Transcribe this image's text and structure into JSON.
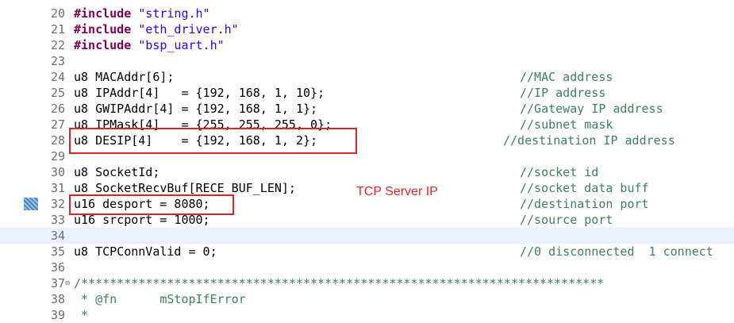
{
  "lines": [
    {
      "num": "20",
      "parts": [
        {
          "t": "#include ",
          "c": "kw"
        },
        {
          "t": "\"string.h\"",
          "c": "str"
        }
      ],
      "comment": ""
    },
    {
      "num": "21",
      "parts": [
        {
          "t": "#include ",
          "c": "kw"
        },
        {
          "t": "\"eth_driver.h\"",
          "c": "str"
        }
      ],
      "comment": ""
    },
    {
      "num": "22",
      "parts": [
        {
          "t": "#include ",
          "c": "kw"
        },
        {
          "t": "\"bsp_uart.h\"",
          "c": "str"
        }
      ],
      "comment": ""
    },
    {
      "num": "23",
      "parts": [],
      "comment": ""
    },
    {
      "num": "24",
      "parts": [
        {
          "t": "u8 MACAddr[6];",
          "c": ""
        }
      ],
      "comment": "//MAC address"
    },
    {
      "num": "25",
      "parts": [
        {
          "t": "u8 IPAddr[4]   = {192, 168, 1, 10};",
          "c": ""
        }
      ],
      "comment": "//IP address"
    },
    {
      "num": "26",
      "parts": [
        {
          "t": "u8 GWIPAddr[4] = {192, 168, 1, 1};",
          "c": ""
        }
      ],
      "comment": "//Gateway IP address"
    },
    {
      "num": "27",
      "parts": [
        {
          "t": "u8 IPMask[4]   = {255, 255, 255, 0};",
          "c": ""
        }
      ],
      "comment": "//subnet mask"
    },
    {
      "num": "28",
      "parts": [
        {
          "t": "u8 DESIP[4]    = {192, 168, 1, 2};",
          "c": ""
        }
      ],
      "comment": "//destination IP address"
    },
    {
      "num": "29",
      "parts": [],
      "comment": ""
    },
    {
      "num": "30",
      "parts": [
        {
          "t": "u8 SocketId;",
          "c": ""
        }
      ],
      "comment": "//socket id"
    },
    {
      "num": "31",
      "parts": [
        {
          "t": "u8 SocketRecvBuf[RECE_BUF_LEN];",
          "c": ""
        }
      ],
      "comment": "//socket data buff"
    },
    {
      "num": "32",
      "parts": [
        {
          "t": "u16 desport = 8080;",
          "c": ""
        }
      ],
      "comment": "//destination port"
    },
    {
      "num": "33",
      "parts": [
        {
          "t": "u16 srcport = 1000;",
          "c": ""
        }
      ],
      "comment": "//source port"
    },
    {
      "num": "34",
      "parts": [],
      "comment": ""
    },
    {
      "num": "35",
      "parts": [
        {
          "t": "u8 TCPConnValid = 0;",
          "c": ""
        }
      ],
      "comment": "//0 disconnected  1 connect"
    },
    {
      "num": "36",
      "parts": [],
      "comment": ""
    },
    {
      "num": "37",
      "parts": [
        {
          "t": "/*************************************************************************",
          "c": "cm"
        }
      ],
      "comment": ""
    },
    {
      "num": "38",
      "parts": [
        {
          "t": " * @fn      mStopIfError",
          "c": "cm"
        }
      ],
      "comment": ""
    },
    {
      "num": "39",
      "parts": [
        {
          "t": " *",
          "c": "cm"
        }
      ],
      "comment": ""
    }
  ],
  "annotation": "TCP Server IP"
}
